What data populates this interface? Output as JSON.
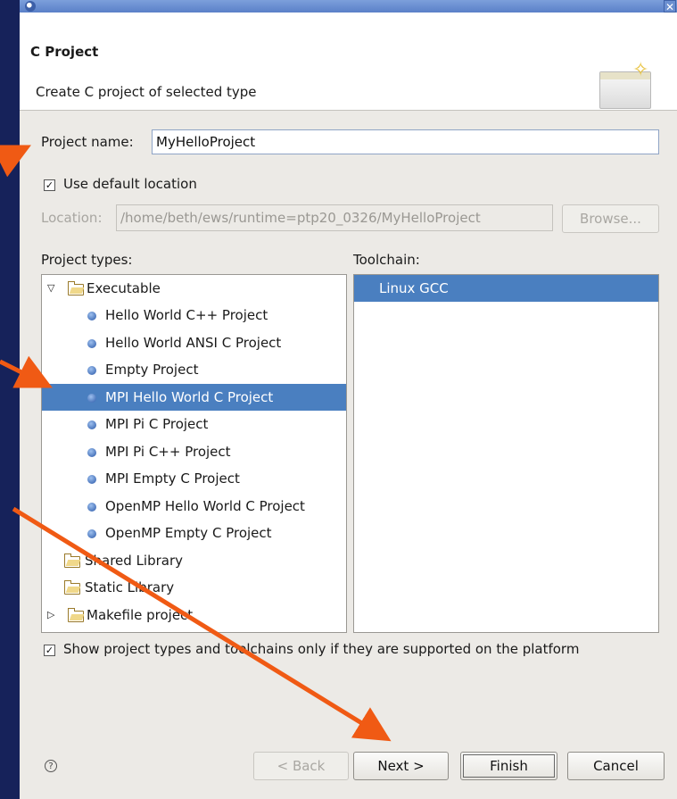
{
  "dialog": {
    "title": "C Project",
    "description": "Create C project of selected type"
  },
  "project_name": {
    "label": "Project name:",
    "value": "MyHelloProject"
  },
  "default_location": {
    "label": "Use default location",
    "checked": true
  },
  "location": {
    "label": "Location:",
    "value": "/home/beth/ews/runtime=ptp20_0326/MyHelloProject",
    "browse_label": "Browse..."
  },
  "project_types": {
    "label": "Project types:",
    "items": [
      {
        "label": "Executable",
        "kind": "folder",
        "expanded": true
      },
      {
        "label": "Hello World C++ Project",
        "kind": "leaf"
      },
      {
        "label": "Hello World ANSI C Project",
        "kind": "leaf"
      },
      {
        "label": "Empty Project",
        "kind": "leaf"
      },
      {
        "label": "MPI Hello World C Project",
        "kind": "leaf",
        "selected": true
      },
      {
        "label": "MPI Pi C Project",
        "kind": "leaf"
      },
      {
        "label": "MPI Pi C++ Project",
        "kind": "leaf"
      },
      {
        "label": "MPI Empty C Project",
        "kind": "leaf"
      },
      {
        "label": "OpenMP Hello World C Project",
        "kind": "leaf"
      },
      {
        "label": "OpenMP Empty C Project",
        "kind": "leaf"
      },
      {
        "label": "Shared Library",
        "kind": "folder"
      },
      {
        "label": "Static Library",
        "kind": "folder"
      },
      {
        "label": "Makefile project",
        "kind": "folder",
        "collapsed": true
      }
    ]
  },
  "toolchain": {
    "label": "Toolchain:",
    "items": [
      "Linux GCC"
    ]
  },
  "filter_checkbox": {
    "label": "Show project types and toolchains only if they are supported on the platform",
    "checked": true
  },
  "buttons": {
    "back": "< Back",
    "next": "Next >",
    "finish": "Finish",
    "cancel": "Cancel"
  },
  "colors": {
    "selection": "#4a7fc0",
    "annotation_arrow": "#f05a14",
    "dialog_background": "#eceae6"
  }
}
